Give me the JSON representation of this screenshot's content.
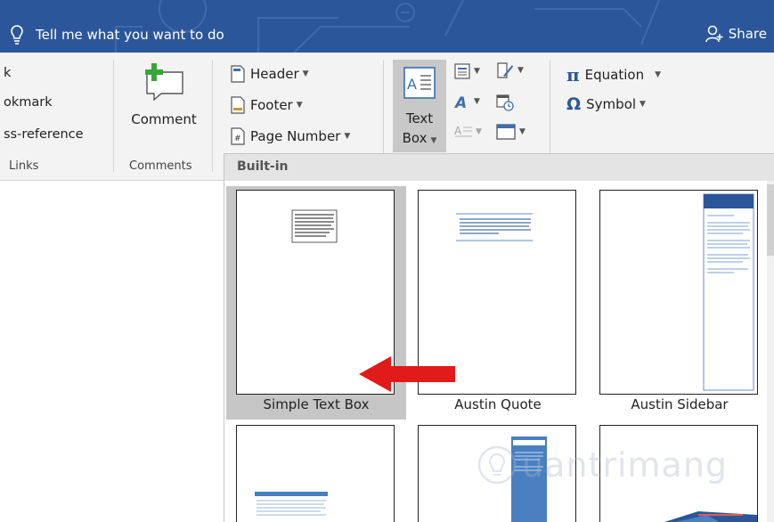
{
  "titlebar": {
    "tell_me": "Tell me what you want to do",
    "share": "Share",
    "bg_color": "#2b579a"
  },
  "ribbon": {
    "links_group": {
      "items": [
        "k",
        "okmark",
        "ss-reference"
      ],
      "label": "Links"
    },
    "comments_group": {
      "button_label": "Comment",
      "label": "Comments"
    },
    "header_footer": {
      "header": "Header",
      "footer": "Footer",
      "page_number": "Page Number"
    },
    "text_group": {
      "text_box_line1": "Text",
      "text_box_line2": "Box"
    },
    "symbols_group": {
      "equation": "Equation",
      "symbol": "Symbol"
    }
  },
  "gallery": {
    "section_title": "Built-in",
    "tiles": [
      {
        "label": "Simple Text Box",
        "selected": true
      },
      {
        "label": "Austin Quote",
        "selected": false
      },
      {
        "label": "Austin Sidebar",
        "selected": false
      }
    ],
    "selection_color": "#c6c6c6"
  },
  "annotation": {
    "arrow_color": "#e11a1a"
  },
  "watermark": {
    "text": "uantrimang"
  }
}
